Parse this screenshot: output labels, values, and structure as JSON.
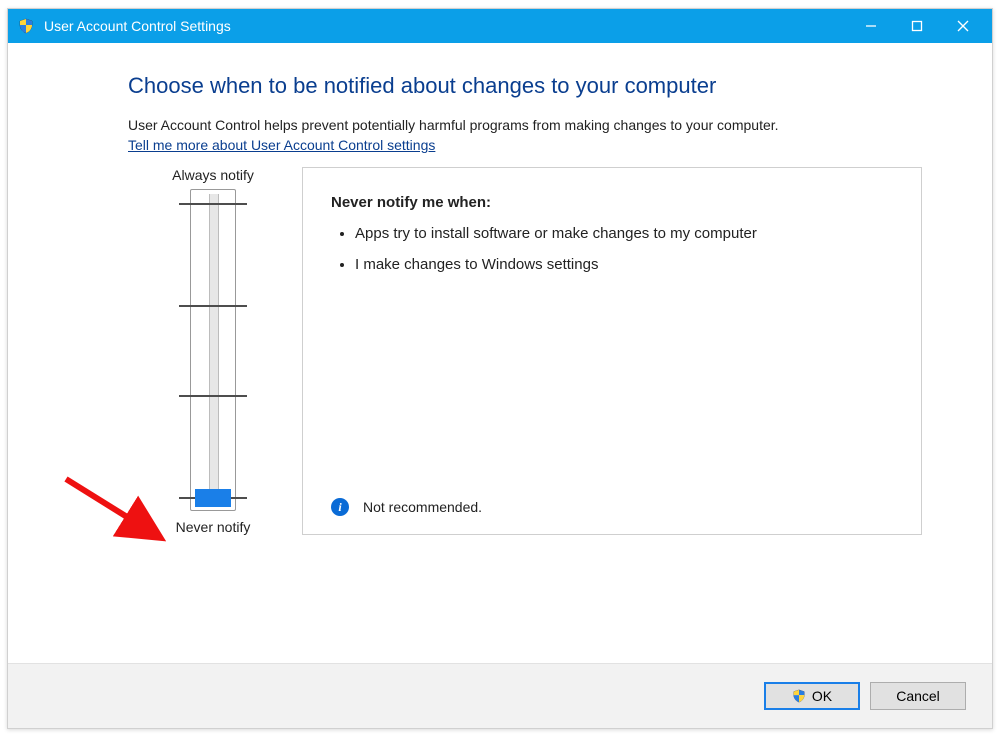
{
  "window": {
    "title": "User Account Control Settings"
  },
  "content": {
    "heading": "Choose when to be notified about changes to your computer",
    "subtext": "User Account Control helps prevent potentially harmful programs from making changes to your computer.",
    "help_link": "Tell me more about User Account Control settings"
  },
  "slider": {
    "top_label": "Always notify",
    "bottom_label": "Never notify",
    "level": 0,
    "levels_total": 4
  },
  "panel": {
    "title": "Never notify me when:",
    "bullets": {
      "b1": "Apps try to install software or make changes to my computer",
      "b2": "I make changes to Windows settings"
    },
    "recommendation": "Not recommended."
  },
  "buttons": {
    "ok": "OK",
    "cancel": "Cancel"
  }
}
